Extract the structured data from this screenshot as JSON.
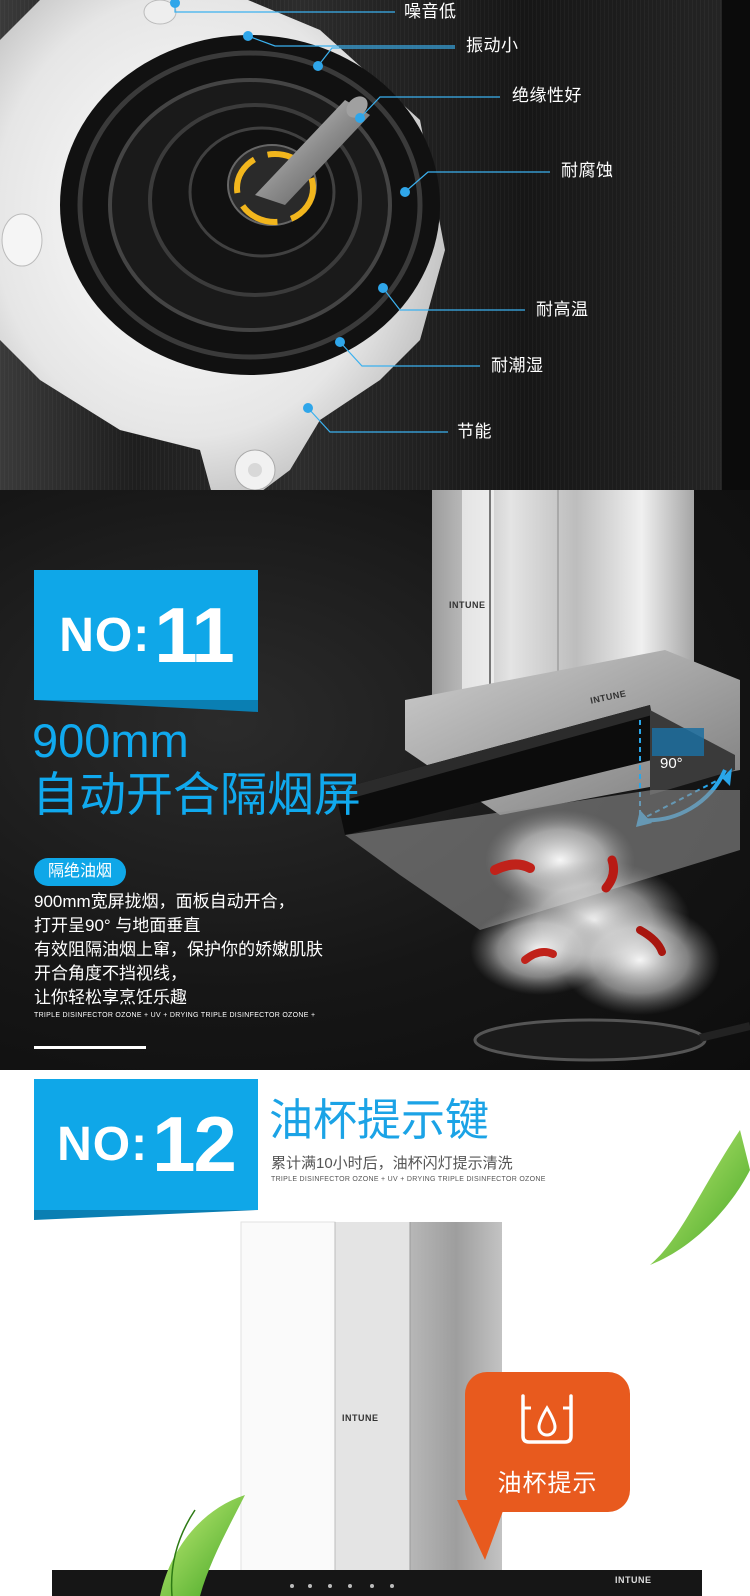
{
  "colors": {
    "accent_blue": "#0fa7e8",
    "accent_orange": "#e85a1e",
    "dark_bg": "#1a1a1a"
  },
  "motor": {
    "callouts": [
      "噪音低",
      "振动小",
      "绝缘性好",
      "耐腐蚀",
      "耐高温",
      "耐潮湿",
      "节能"
    ]
  },
  "feature_11": {
    "badge_prefix": "NO:",
    "badge_number": "11",
    "title_line1": "900mm",
    "title_line2": "自动开合隔烟屏",
    "tag": "隔绝油烟",
    "body": [
      "900mm宽屏拢烟，面板自动开合，",
      "打开呈90°  与地面垂直",
      "有效阻隔油烟上窜，保护你的娇嫩肌肤",
      "开合角度不挡视线，",
      "让你轻松享烹饪乐趣"
    ],
    "caption": "TRIPLE DISINFECTOR  OZONE + UV + DRYING  TRIPLE DISINFECTOR  OZONE +",
    "angle_label": "90°",
    "brand": "INTUNE"
  },
  "feature_12": {
    "badge_prefix": "NO:",
    "badge_number": "12",
    "title": "油杯提示键",
    "subtitle": "累计满10小时后，油杯闪灯提示清洗",
    "caption": "TRIPLE DISINFECTOR  OZONE + UV + DRYING  TRIPLE DISINFECTOR  OZONE",
    "bubble_label": "油杯提示",
    "brand": "INTUNE",
    "icon": "oil-cup-icon"
  }
}
